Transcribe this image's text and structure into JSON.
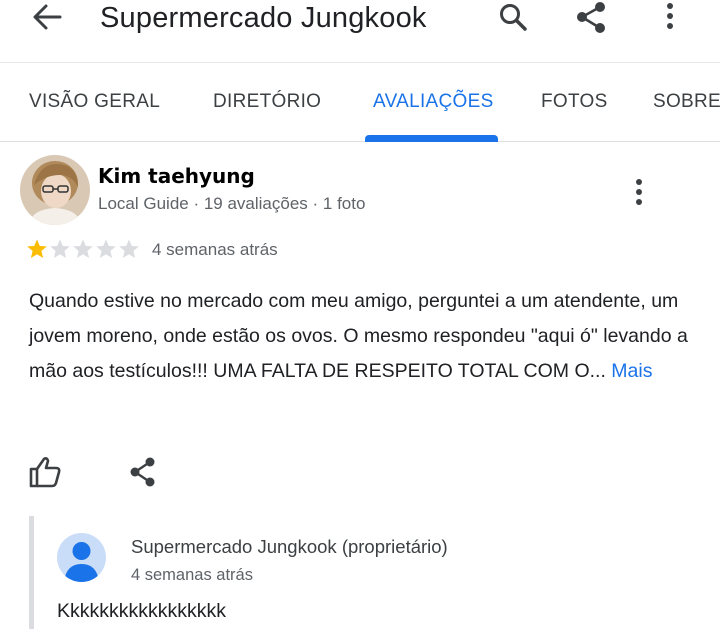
{
  "header": {
    "title": "Supermercado Jungkook",
    "icons": [
      "back-arrow-icon",
      "search-icon",
      "share-icon",
      "more-vert-icon"
    ]
  },
  "tabs": [
    {
      "label": "VISÃO GERAL",
      "active": false
    },
    {
      "label": "DIRETÓRIO",
      "active": false
    },
    {
      "label": "AVALIAÇÕES",
      "active": true
    },
    {
      "label": "FOTOS",
      "active": false
    },
    {
      "label": "SOBRE",
      "active": false
    }
  ],
  "review": {
    "author": "Kim taehyung",
    "meta": "Local Guide · 19 avaliações · 1 foto",
    "rating": 1,
    "rating_max": 5,
    "time": "4 semanas atrás",
    "text": "Quando estive no mercado com meu amigo, perguntei a um atendente, um jovem moreno, onde estão os ovos. O mesmo respondeu \"aqui ó\" levando a mão aos testículos!!! UMA FALTA DE RESPEITO TOTAL COM O... ",
    "more_label": "Mais"
  },
  "reply": {
    "name": "Supermercado Jungkook (proprietário)",
    "time": "4 semanas atrás",
    "text": "Kkkkkkkkkkkkkkkkk"
  },
  "colors": {
    "accent": "#1a73e8",
    "star_filled": "#fbbc04",
    "star_empty": "#dadce0"
  }
}
